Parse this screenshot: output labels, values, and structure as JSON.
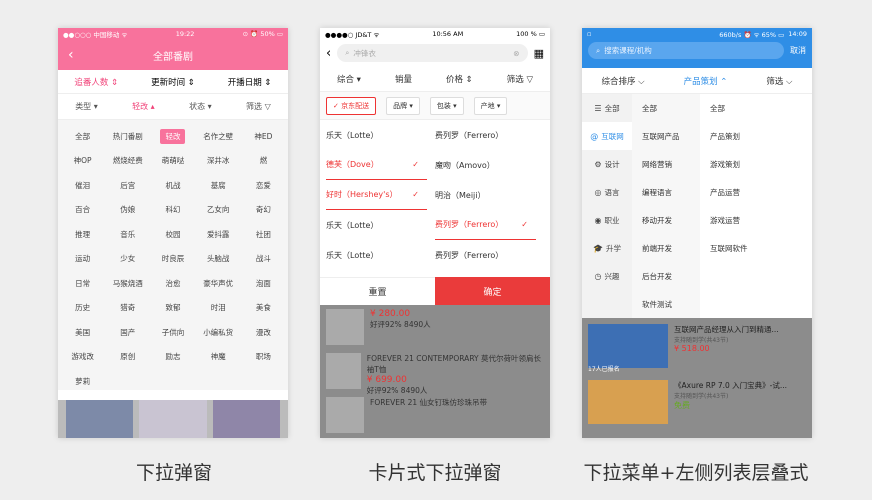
{
  "phone1": {
    "status": {
      "left": "●●○○○ 中国移动 ᯤ",
      "time": "19:22",
      "right": "⊙ ⏰ 50% ▭"
    },
    "title": "全部番剧",
    "back": "‹",
    "sort": [
      "追番人数 ⇕",
      "更新时间 ⇕",
      "开播日期 ⇕"
    ],
    "filters": [
      "类型",
      "轻改",
      "状态",
      "筛选"
    ],
    "tags": [
      "全部",
      "热门番剧",
      "轻改",
      "名作之壁",
      "神ED",
      "神OP",
      "燃烧经费",
      "萌萌哒",
      "深井冰",
      "燃",
      "催泪",
      "后宫",
      "机战",
      "基腐",
      "恋爱",
      "百合",
      "伪娘",
      "科幻",
      "乙女向",
      "奇幻",
      "推理",
      "音乐",
      "校园",
      "爱抖露",
      "社团",
      "运动",
      "少女",
      "时良辰",
      "头脑战",
      "战斗",
      "日常",
      "马猴烧酒",
      "治愈",
      "豪华声优",
      "泡面",
      "历史",
      "猎奇",
      "致郁",
      "时泪",
      "美食",
      "美国",
      "国产",
      "子供向",
      "小编私货",
      "漫改",
      "游戏改",
      "原创",
      "励志",
      "神魔",
      "职场",
      "萝莉"
    ],
    "caption": "下拉弹窗"
  },
  "phone2": {
    "status": {
      "left": "●●●●○ JD&T ᯤ",
      "time": "10:56 AM",
      "right": "100 % ▭"
    },
    "search_placeholder": "冲锋衣",
    "tabs": [
      "综合 ▾",
      "销量",
      "价格 ⇕",
      "筛选 ▽"
    ],
    "chips": [
      "✓ 京东配送",
      "品牌 ▾",
      "包装 ▾",
      "产地 ▾"
    ],
    "brands": [
      {
        "name": "乐天（Lotte）",
        "on": false
      },
      {
        "name": "费列罗（Ferrero）",
        "on": false
      },
      {
        "name": "德芙（Dove）",
        "on": true
      },
      {
        "name": "魔吻（Amovo）",
        "on": false
      },
      {
        "name": "好时（Hershey's）",
        "on": true
      },
      {
        "name": "明治（Meiji）",
        "on": false
      },
      {
        "name": "乐天（Lotte）",
        "on": false
      },
      {
        "name": "费列罗（Ferrero）",
        "on": true
      },
      {
        "name": "乐天（Lotte）",
        "on": false
      },
      {
        "name": "费列罗（Ferrero）",
        "on": false
      }
    ],
    "reset": "重置",
    "confirm": "确定",
    "products": [
      {
        "title": "",
        "price": "¥ 280.00",
        "meta": "好评92%  8490人"
      },
      {
        "title": "FOREVER 21 CONTEMPORARY 莫代尔荷叶领肩长袖T恤",
        "price": "¥ 699.00",
        "meta": "好评92%  8490人"
      },
      {
        "title": "FOREVER 21 仙女钉珠仿珍珠吊带",
        "price": "",
        "meta": ""
      }
    ],
    "caption": "卡片式下拉弹窗"
  },
  "phone3": {
    "status": {
      "left": "▫",
      "time": "14:09",
      "right": "660b/s ⏰ ᯤ 65% ▭"
    },
    "search_placeholder": "搜索课程/机构",
    "cancel": "取消",
    "tabs": [
      "综合排序 ⌵",
      "产品策划 ⌃",
      "筛选 ⌵"
    ],
    "col1": [
      {
        "icon": "☰",
        "label": "全部",
        "on": false
      },
      {
        "icon": "@",
        "label": "互联网",
        "on": true
      },
      {
        "icon": "⚙",
        "label": "设计",
        "on": false
      },
      {
        "icon": "◎",
        "label": "语言",
        "on": false
      },
      {
        "icon": "◉",
        "label": "职业",
        "on": false
      },
      {
        "icon": "🎓",
        "label": "升学",
        "on": false
      },
      {
        "icon": "◷",
        "label": "兴趣",
        "on": false
      }
    ],
    "col2": [
      "全部",
      "互联网产品",
      "网络营销",
      "编程语言",
      "移动开发",
      "前端开发",
      "后台开发",
      "软件测试"
    ],
    "col3": [
      "全部",
      "产品策划",
      "游戏策划",
      "产品运营",
      "游戏运营",
      "互联网软件"
    ],
    "courses": [
      {
        "title": "互联网产品经理从入门到精通...",
        "sub": "支持随到学(共43节)",
        "price": "¥ 518.00",
        "tag": "17人已报名"
      },
      {
        "title": "《Axure RP 7.0 入门宝典》-试...",
        "sub": "支持随到学(共43节)",
        "price": "免费",
        "tag": ""
      }
    ],
    "caption": "下拉菜单+左侧列表层叠式"
  },
  "colors": {
    "pink": "#f8729c",
    "red": "#ea3b3b",
    "blue": "#2f8ee6"
  }
}
